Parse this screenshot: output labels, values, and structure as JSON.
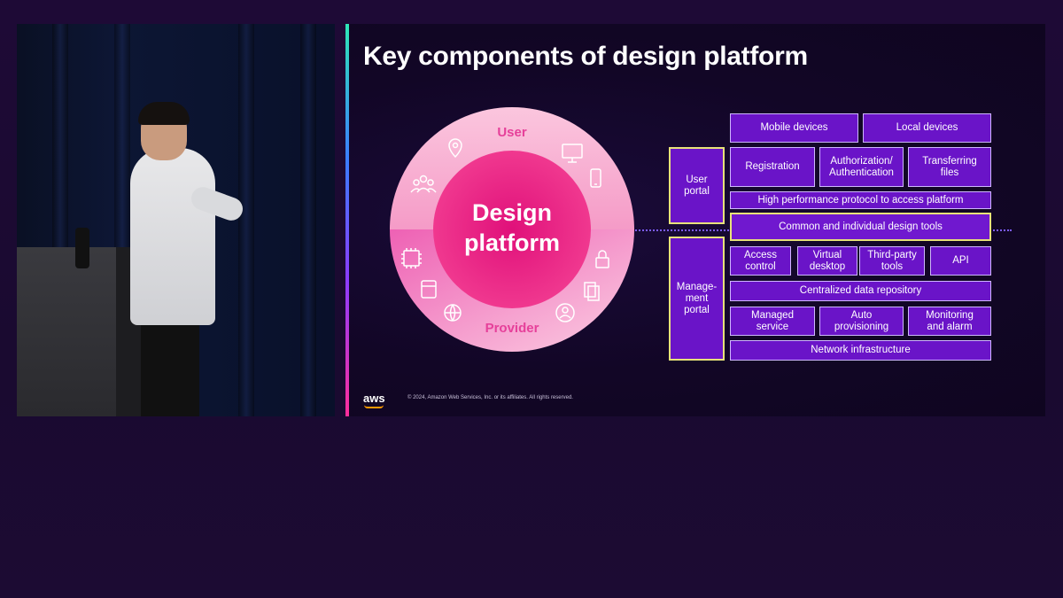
{
  "slide": {
    "title": "Key components of design platform",
    "copyright": "© 2024, Amazon Web Services, Inc. or its affiliates. All rights reserved.",
    "logo": "aws"
  },
  "circle": {
    "center_line1": "Design",
    "center_line2": "platform",
    "top_label": "User",
    "bottom_label": "Provider",
    "user_icons": [
      "location-pin-icon",
      "group-icon",
      "monitor-icon",
      "phone-icon"
    ],
    "provider_icons": [
      "chip-icon",
      "storage-icon",
      "globe-network-icon",
      "lock-icon",
      "documents-icon",
      "admin-user-icon"
    ]
  },
  "portals": {
    "user": "User\nportal",
    "management": "Manage-\nment\nportal"
  },
  "components": {
    "mobile": "Mobile devices",
    "local": "Local devices",
    "registration": "Registration",
    "authn": "Authorization/\nAuthentication",
    "transfer": "Transferring\nfiles",
    "protocol": "High performance protocol to access platform",
    "design_tools": "Common and individual design tools",
    "access": "Access\ncontrol",
    "vdesktop": "Virtual\ndesktop",
    "thirdparty": "Third-party\ntools",
    "api": "API",
    "repository": "Centralized data repository",
    "managed": "Managed\nservice",
    "autoprov": "Auto\nprovisioning",
    "monitoring": "Monitoring\nand alarm",
    "network": "Network infrastructure"
  },
  "colors": {
    "box_fill": "#6a14c8",
    "portal_border": "#e8e27a",
    "ring_light": "#f7a8d0",
    "ring_core": "#e6157e"
  }
}
